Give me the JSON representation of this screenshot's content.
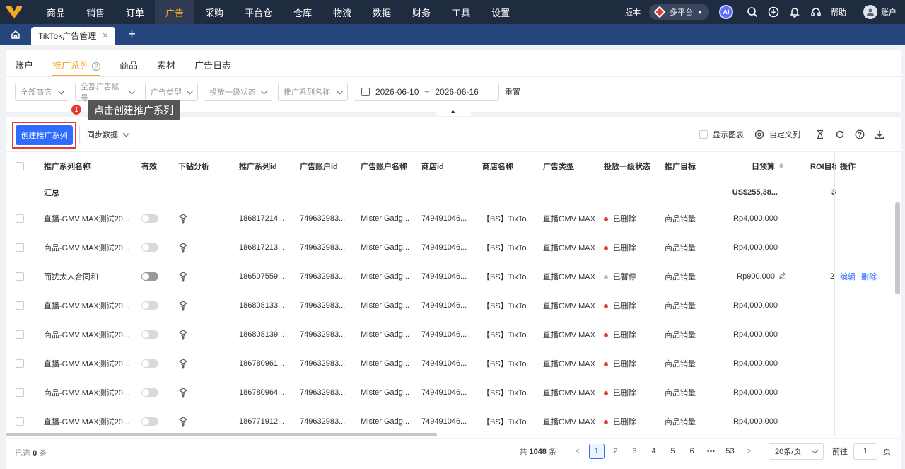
{
  "topnav": {
    "items": [
      "商品",
      "销售",
      "订单",
      "广告",
      "采购",
      "平台仓",
      "仓库",
      "物流",
      "数据",
      "财务",
      "工具",
      "设置"
    ],
    "active_index": 3,
    "version_label": "版本",
    "platform_label": "多平台",
    "ai_label": "AI",
    "help_label": "帮助",
    "account_label": "账户"
  },
  "tabs": {
    "page_tab": "TikTok广告管理"
  },
  "subtabs": [
    "账户",
    "推广系列",
    "商品",
    "素材",
    "广告日志"
  ],
  "subtab_active": 1,
  "filters": {
    "shop": "全部商店",
    "account": "全部广告账号",
    "ad_type": "广告类型",
    "status": "投放一级状态",
    "name": "推广系列名称",
    "date_start": "2026-06-10",
    "date_sep": "~",
    "date_end": "2026-06-16",
    "reset": "重置"
  },
  "tooltip": {
    "number": "1",
    "text": "点击创建推广系列"
  },
  "toolbar": {
    "create": "创建推广系列",
    "sync": "同步数据",
    "show_chart": "显示图表",
    "custom_columns": "自定义列"
  },
  "table": {
    "headers": [
      "推广系列名称",
      "有效",
      "下钻分析",
      "推广系列id",
      "广告账户id",
      "广告账户名称",
      "商店id",
      "商店名称",
      "广告类型",
      "投放一级状态",
      "推广目标",
      "日预算",
      "ROI目标",
      "操作"
    ],
    "summary": {
      "label": "汇总",
      "budget": "US$255,38...",
      "roi": "3"
    },
    "rows": [
      {
        "name": "直播-GMV MAX测试20...",
        "id": "186817214...",
        "acc_id": "749632983...",
        "acc_name": "Mister Gadg...",
        "shop_id": "749491046...",
        "shop_name": "【BS】TikTo...",
        "type": "直播GMV MAX",
        "status": "已删除",
        "goal": "商品销量",
        "budget": "Rp4,000,000",
        "roi": "",
        "edit": "",
        "del": ""
      },
      {
        "name": "商品-GMV MAX测试20...",
        "id": "186817213...",
        "acc_id": "749632983...",
        "acc_name": "Mister Gadg...",
        "shop_id": "749491046...",
        "shop_name": "【BS】TikTo...",
        "type": "直播GMV MAX",
        "status": "已删除",
        "goal": "商品销量",
        "budget": "Rp4,000,000",
        "roi": "",
        "edit": "",
        "del": ""
      },
      {
        "name": "而犹太人合同和",
        "id": "186507559...",
        "acc_id": "749632983...",
        "acc_name": "Mister Gadg...",
        "shop_id": "749491046...",
        "shop_name": "【BS】TikTo...",
        "type": "直播GMV MAX",
        "status": "已暂停",
        "goal": "商品销量",
        "budget": "Rp900,000",
        "roi": "2",
        "edit": "编辑",
        "del": "删除"
      },
      {
        "name": "直播-GMV MAX测试20...",
        "id": "186808133...",
        "acc_id": "749632983...",
        "acc_name": "Mister Gadg...",
        "shop_id": "749491046...",
        "shop_name": "【BS】TikTo...",
        "type": "直播GMV MAX",
        "status": "已删除",
        "goal": "商品销量",
        "budget": "Rp4,000,000",
        "roi": "",
        "edit": "",
        "del": ""
      },
      {
        "name": "商品-GMV MAX测试20...",
        "id": "186808139...",
        "acc_id": "749632983...",
        "acc_name": "Mister Gadg...",
        "shop_id": "749491046...",
        "shop_name": "【BS】TikTo...",
        "type": "直播GMV MAX",
        "status": "已删除",
        "goal": "商品销量",
        "budget": "Rp4,000,000",
        "roi": "",
        "edit": "",
        "del": ""
      },
      {
        "name": "直播-GMV MAX测试20...",
        "id": "186780961...",
        "acc_id": "749632983...",
        "acc_name": "Mister Gadg...",
        "shop_id": "749491046...",
        "shop_name": "【BS】TikTo...",
        "type": "直播GMV MAX",
        "status": "已删除",
        "goal": "商品销量",
        "budget": "Rp4,000,000",
        "roi": "",
        "edit": "",
        "del": ""
      },
      {
        "name": "商品-GMV MAX测试20...",
        "id": "186780964...",
        "acc_id": "749632983...",
        "acc_name": "Mister Gadg...",
        "shop_id": "749491046...",
        "shop_name": "【BS】TikTo...",
        "type": "直播GMV MAX",
        "status": "已删除",
        "goal": "商品销量",
        "budget": "Rp4,000,000",
        "roi": "",
        "edit": "",
        "del": ""
      },
      {
        "name": "直播-GMV MAX测试20...",
        "id": "186771912...",
        "acc_id": "749632983...",
        "acc_name": "Mister Gadg...",
        "shop_id": "749491046...",
        "shop_name": "【BS】TikTo...",
        "type": "直播GMV MAX",
        "status": "已删除",
        "goal": "商品销量",
        "budget": "Rp4,000,000",
        "roi": "",
        "edit": "",
        "del": ""
      }
    ]
  },
  "footer": {
    "selected_prefix": "已选",
    "selected_count": "0",
    "selected_suffix": "条",
    "total_prefix": "共",
    "total": "1048",
    "total_suffix": "条",
    "pages": [
      "1",
      "2",
      "3",
      "4",
      "5",
      "6",
      "•••",
      "53"
    ],
    "current_page": "1",
    "page_size": "20条/页",
    "goto_label": "前往",
    "goto_value": "1",
    "goto_suffix": "页"
  },
  "colors": {
    "nav_bg": "#1f2b3f",
    "tab_bar": "#25467d",
    "accent": "#f5a623",
    "primary": "#2f6bff",
    "danger": "#e53935"
  }
}
